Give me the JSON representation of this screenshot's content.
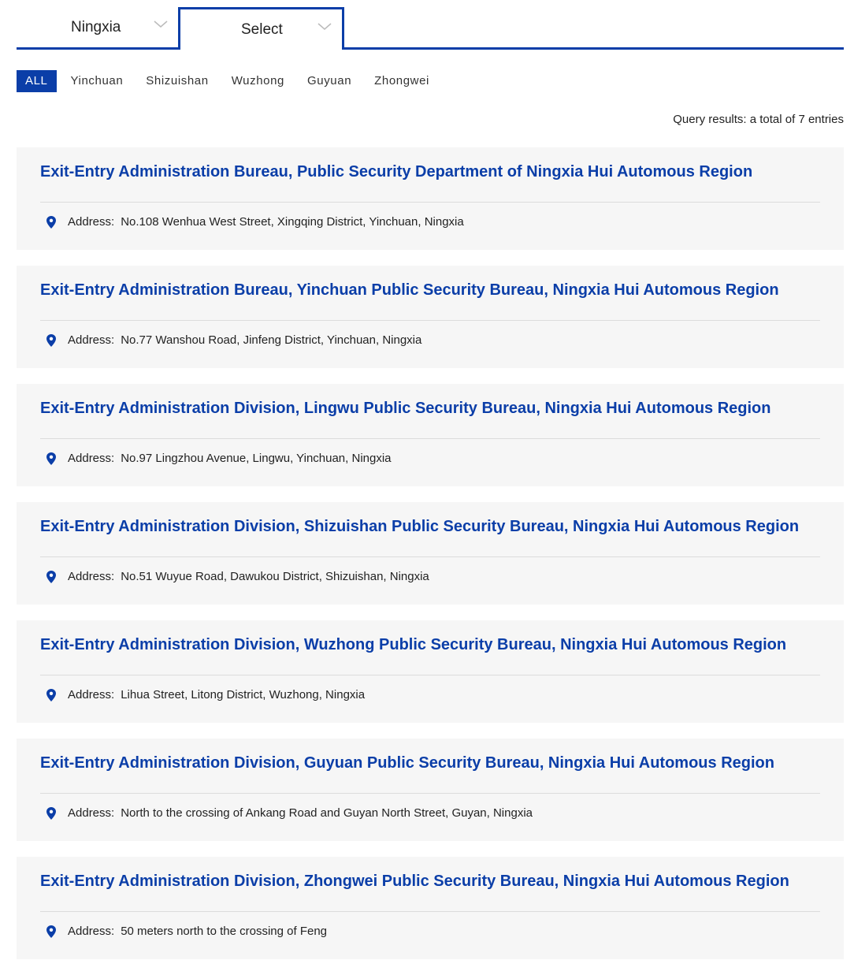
{
  "selectors": {
    "province": "Ningxia",
    "city": "Select"
  },
  "filters": [
    {
      "label": "ALL",
      "active": true
    },
    {
      "label": "Yinchuan",
      "active": false
    },
    {
      "label": "Shizuishan",
      "active": false
    },
    {
      "label": "Wuzhong",
      "active": false
    },
    {
      "label": "Guyuan",
      "active": false
    },
    {
      "label": "Zhongwei",
      "active": false
    }
  ],
  "query_text": "Query results: a total of 7 entries",
  "address_label": "Address:",
  "colors": {
    "accent": "#0b3ea8",
    "card_bg": "#f6f6f6"
  },
  "entries": [
    {
      "title": "Exit-Entry Administration Bureau, Public Security Department of Ningxia Hui Automous Region",
      "address": "No.108 Wenhua West Street, Xingqing District, Yinchuan, Ningxia"
    },
    {
      "title": "Exit-Entry Administration Bureau, Yinchuan Public Security Bureau, Ningxia Hui Automous Region",
      "address": "No.77 Wanshou Road, Jinfeng District, Yinchuan, Ningxia"
    },
    {
      "title": "Exit-Entry Administration Division, Lingwu Public Security Bureau, Ningxia Hui Automous Region",
      "address": "No.97 Lingzhou Avenue, Lingwu, Yinchuan, Ningxia"
    },
    {
      "title": "Exit-Entry Administration Division, Shizuishan Public Security Bureau, Ningxia Hui Automous Region",
      "address": "No.51 Wuyue Road, Dawukou District, Shizuishan, Ningxia"
    },
    {
      "title": "Exit-Entry Administration Division, Wuzhong Public Security Bureau, Ningxia Hui Automous Region",
      "address": "Lihua Street, Litong District, Wuzhong, Ningxia"
    },
    {
      "title": "Exit-Entry Administration Division, Guyuan Public Security Bureau, Ningxia Hui Automous Region",
      "address": "North to the crossing of Ankang Road and Guyan North Street, Guyan, Ningxia"
    },
    {
      "title": "Exit-Entry Administration Division, Zhongwei Public Security Bureau, Ningxia Hui Automous Region",
      "address": "50 meters north to the crossing of Feng"
    }
  ]
}
